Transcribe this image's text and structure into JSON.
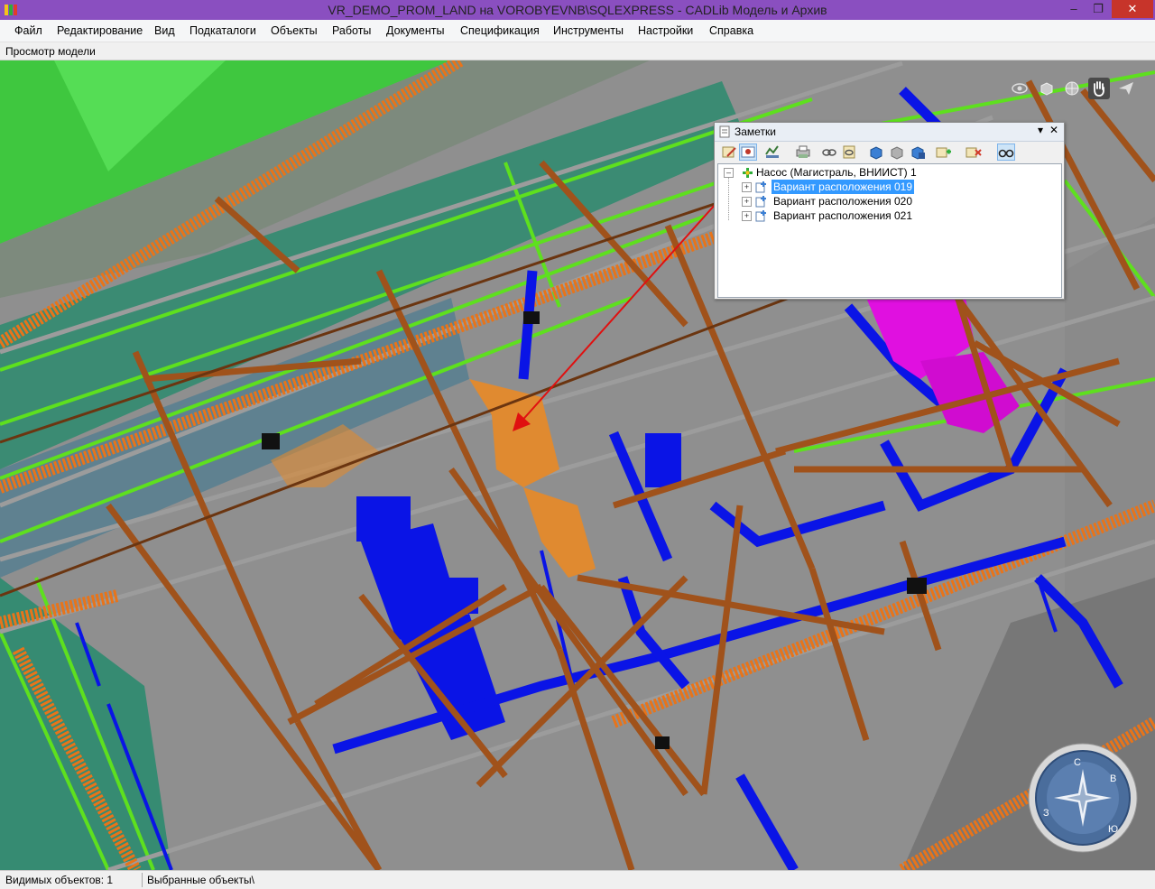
{
  "window": {
    "title": "VR_DEMO_PROM_LAND на VOROBYEVNB\\SQLEXPRESS - CADLib Модель и Архив",
    "app_icon": "cadlib-app-icon",
    "controls": {
      "minimize": "–",
      "maximize": "❐",
      "close": "✕"
    }
  },
  "menu": {
    "items": [
      "Файл",
      "Редактирование",
      "Вид",
      "Подкаталоги",
      "Объекты",
      "Работы",
      "Документы",
      "Спецификация",
      "Инструменты",
      "Настройки",
      "Справка"
    ]
  },
  "view": {
    "title": "Просмотр модели",
    "nav_tools": [
      "eye-icon",
      "cube-icon",
      "globe-icon",
      "hand-pan-icon",
      "paper-plane-icon"
    ],
    "active_nav_tool": "hand-pan-icon",
    "compass_letters": [
      "С",
      "В",
      "Ю",
      "З"
    ]
  },
  "notes_panel": {
    "title": "Заметки",
    "pin_label": "▾",
    "close_label": "✕",
    "toolbar": [
      "note-edit-icon",
      "note-view-icon",
      "filter-icon",
      "print-icon",
      "link-icon",
      "link-list-icon",
      "cube-blue-icon",
      "cube-gray-icon",
      "cube-save-icon",
      "add-note-icon",
      "delete-note-icon",
      "glasses-icon"
    ],
    "tree": {
      "root": {
        "label": "Насос (Магистраль, ВНИИСТ) 1",
        "expander": "–"
      },
      "children": [
        {
          "label": "Вариант расположения 019",
          "expander": "+",
          "selected": true
        },
        {
          "label": "Вариант расположения 020",
          "expander": "+",
          "selected": false
        },
        {
          "label": "Вариант расположения 021",
          "expander": "+",
          "selected": false
        }
      ]
    }
  },
  "status": {
    "visible_objects": "Видимых объектов: 1",
    "selected_objects": "Выбранные объекты\\"
  },
  "colors": {
    "titlebar": "#8a4fc0",
    "steel": "#a0521b",
    "pipe_blue": "#0a14e6",
    "cable_tray": "#e8741a",
    "green_frame": "#5ee01e",
    "pump_highlight": "#e08a30",
    "magenta_equipment": "#e010e0",
    "arrow": "#e01010",
    "selection": "#3399ff"
  }
}
